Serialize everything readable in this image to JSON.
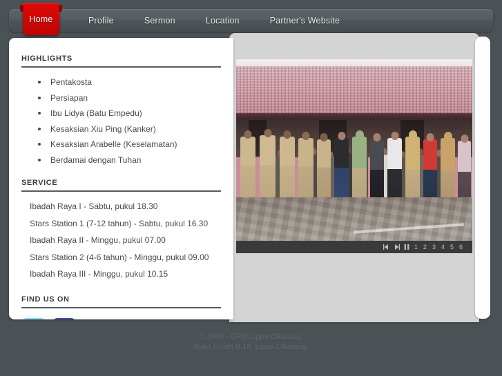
{
  "nav": {
    "items": [
      {
        "label": "Home",
        "active": true
      },
      {
        "label": "Profile",
        "active": false
      },
      {
        "label": "Sermon",
        "active": false
      },
      {
        "label": "Location",
        "active": false
      },
      {
        "label": "Partner's Website",
        "active": false
      }
    ]
  },
  "sidebar": {
    "highlights": {
      "title": "HIGHLIGHTS",
      "items": [
        "Pentakosta",
        "Persiapan",
        "Ibu Lidya (Batu Empedu)",
        "Kesaksian Xiu Ping (Kanker)",
        "Kesaksian Arabelle (Keselamatan)",
        "Berdamai dengan Tuhan"
      ]
    },
    "service": {
      "title": "SERVICE",
      "items": [
        "Ibadah Raya I - Sabtu, pukul 18.30",
        "Stars Station 1 (7-12 tahun) - Sabtu, pukul 16.30",
        "Ibadah Raya II - Minggu, pukul 07.00",
        "Stars Station 2 (4-6 tahun) - Minggu, pukul 09.00",
        "Ibadah Raya III - Minggu, pukul 10.15"
      ]
    },
    "find_us_on": {
      "title": "FIND US ON",
      "social": [
        {
          "name": "twitter-icon",
          "label": "Twitter"
        },
        {
          "name": "facebook-icon",
          "label": "Facebook"
        }
      ]
    }
  },
  "slideshow": {
    "image_alt": "Group photo of people in khaki uniforms and civilian clothes standing in a paved courtyard in front of a tile-roofed building",
    "controls": {
      "previous": "◀|",
      "next": "|▶",
      "pause": "❙❙",
      "slides": [
        "1",
        "2",
        "3",
        "4",
        "5",
        "6"
      ]
    }
  },
  "footer": {
    "line1": "© 2009 - GPdI Lippo Cikarang.",
    "line2": "Ruko Union B.18, Lippo Cikarang."
  },
  "colors": {
    "page_background": "#4a5256",
    "navbar": "#545c60",
    "active_tab": "#d20606",
    "panel_white": "#ffffff",
    "panel_gray": "#d4d4d4",
    "controls_bar": "#3a3a3a",
    "twitter": "#55c3e8",
    "facebook": "#243266"
  }
}
